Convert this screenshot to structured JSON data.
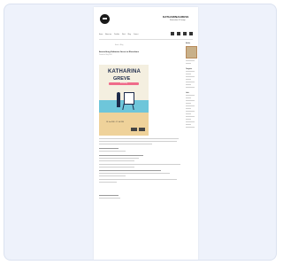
{
  "site": {
    "brand": "KATHARINAGREVE",
    "tagline": "Illustration & Design"
  },
  "nav": {
    "items": [
      "Home",
      "About me",
      "Portfolio",
      "Work",
      "Blog",
      "Contact"
    ],
    "icons": [
      "instagram-icon",
      "facebook-icon",
      "rss-icon",
      "search-icon"
    ]
  },
  "breadcrumb": "Home » Blog",
  "post": {
    "title": "Ausstellung Katharina Greve im Ehrenhaus",
    "meta": "Posted on May 2016"
  },
  "poster": {
    "name_line1": "KATHARINA",
    "name_line2": "GREVE",
    "subtitle": "Ausstellung",
    "dates": "18. Juni 2016 - 17. Juli 2016"
  },
  "sidebar": {
    "headings": [
      "Archive",
      "Categories",
      "Links"
    ]
  },
  "colors": {
    "frame_bg": "#eef2fb",
    "poster_sea": "#6ec6da",
    "poster_sand": "#efd29a",
    "poster_accent": "#ef6b8a",
    "ink": "#1c2a4a"
  }
}
